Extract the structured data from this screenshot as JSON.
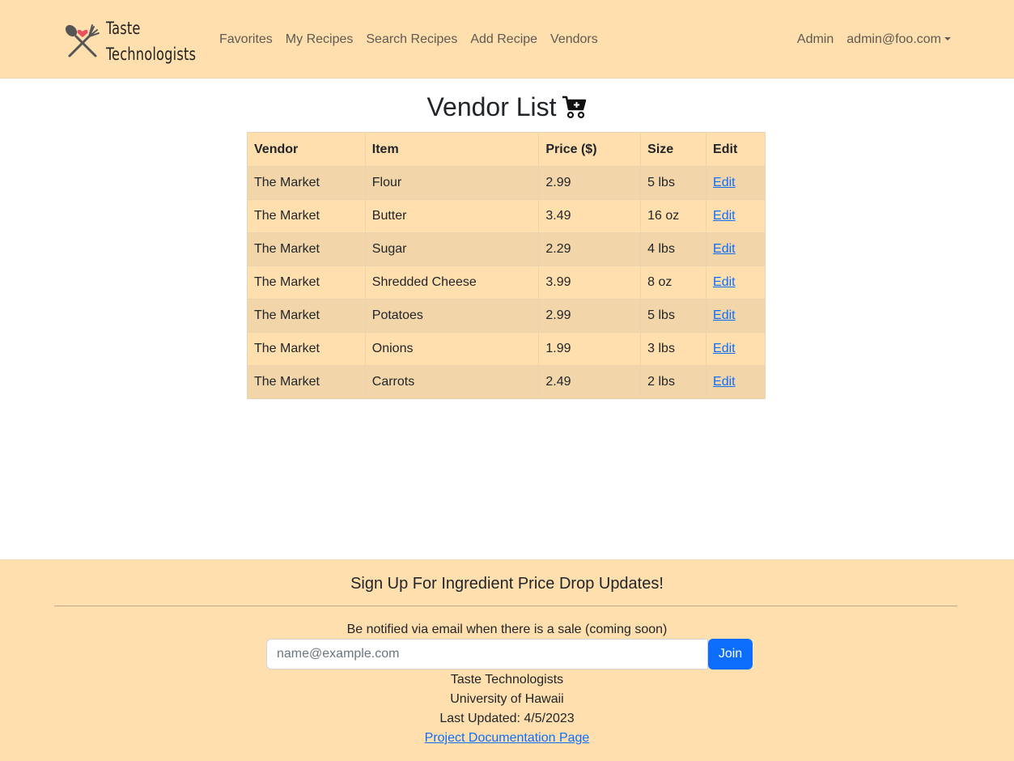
{
  "brand": {
    "line1": "Taste",
    "line2": "Technologists",
    "logo_icon": "fork-spoon-heart-icon"
  },
  "nav": {
    "links": [
      "Favorites",
      "My Recipes",
      "Search Recipes",
      "Add Recipe",
      "Vendors"
    ],
    "admin": "Admin",
    "user": "admin@foo.com"
  },
  "page": {
    "title": "Vendor List",
    "title_icon": "cart-plus-icon"
  },
  "table": {
    "headers": [
      "Vendor",
      "Item",
      "Price ($)",
      "Size",
      "Edit"
    ],
    "rows": [
      {
        "vendor": "The Market",
        "item": "Flour",
        "price": "2.99",
        "size": "5 lbs",
        "edit": "Edit"
      },
      {
        "vendor": "The Market",
        "item": "Butter",
        "price": "3.49",
        "size": "16 oz",
        "edit": "Edit"
      },
      {
        "vendor": "The Market",
        "item": "Sugar",
        "price": "2.29",
        "size": "4 lbs",
        "edit": "Edit"
      },
      {
        "vendor": "The Market",
        "item": "Shredded Cheese",
        "price": "3.99",
        "size": "8 oz",
        "edit": "Edit"
      },
      {
        "vendor": "The Market",
        "item": "Potatoes",
        "price": "2.99",
        "size": "5 lbs",
        "edit": "Edit"
      },
      {
        "vendor": "The Market",
        "item": "Onions",
        "price": "1.99",
        "size": "3 lbs",
        "edit": "Edit"
      },
      {
        "vendor": "The Market",
        "item": "Carrots",
        "price": "2.49",
        "size": "2 lbs",
        "edit": "Edit"
      }
    ]
  },
  "footer": {
    "heading": "Sign Up For Ingredient Price Drop Updates!",
    "note": "Be notified via email when there is a sale (coming soon)",
    "email_placeholder": "name@example.com",
    "join_label": "Join",
    "org": "Taste Technologists",
    "university": "University of Hawaii",
    "updated": "Last Updated: 4/5/2023",
    "doc_link": "Project Documentation Page"
  },
  "colors": {
    "nav_bg": "#ffdfae",
    "row_dark": "#f2d6a9",
    "row_light": "#ffdfae",
    "link": "#0d6efd",
    "button": "#0d6efd"
  }
}
